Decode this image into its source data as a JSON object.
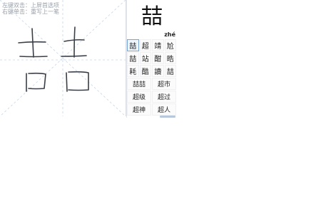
{
  "hints": {
    "left_click": "左键双击：上屏首选项",
    "right_click": "右键单击：重写上一笔"
  },
  "candidate": {
    "main_char": "喆",
    "pinyin": "zhé"
  },
  "single_chars": [
    [
      "喆",
      "超",
      "靖",
      "尬"
    ],
    [
      "喆",
      "站",
      "酣",
      "晧"
    ],
    [
      "耗",
      "酷",
      "讀",
      "喆"
    ]
  ],
  "phrases": [
    [
      "喆喆",
      "超市"
    ],
    [
      "超级",
      "超过"
    ],
    [
      "超神",
      "超人"
    ]
  ],
  "colors": {
    "selected_border": "#7aa6d6",
    "stroke": "#3a3f47"
  }
}
